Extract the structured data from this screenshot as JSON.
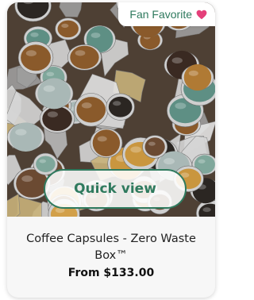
{
  "product_card": {
    "badge": {
      "label": "Fan Favorite",
      "icon": "heart-icon",
      "icon_color": "#e4407a"
    },
    "image": {
      "subject": "coffee-capsules-pile"
    },
    "quick_view_label": "Quick view",
    "title": "Coffee Capsules - Zero Waste Box™",
    "price": "From $133.00"
  },
  "colors": {
    "accent": "#2f7a5e",
    "card_background": "#f7f7f7",
    "text": "#222222"
  }
}
